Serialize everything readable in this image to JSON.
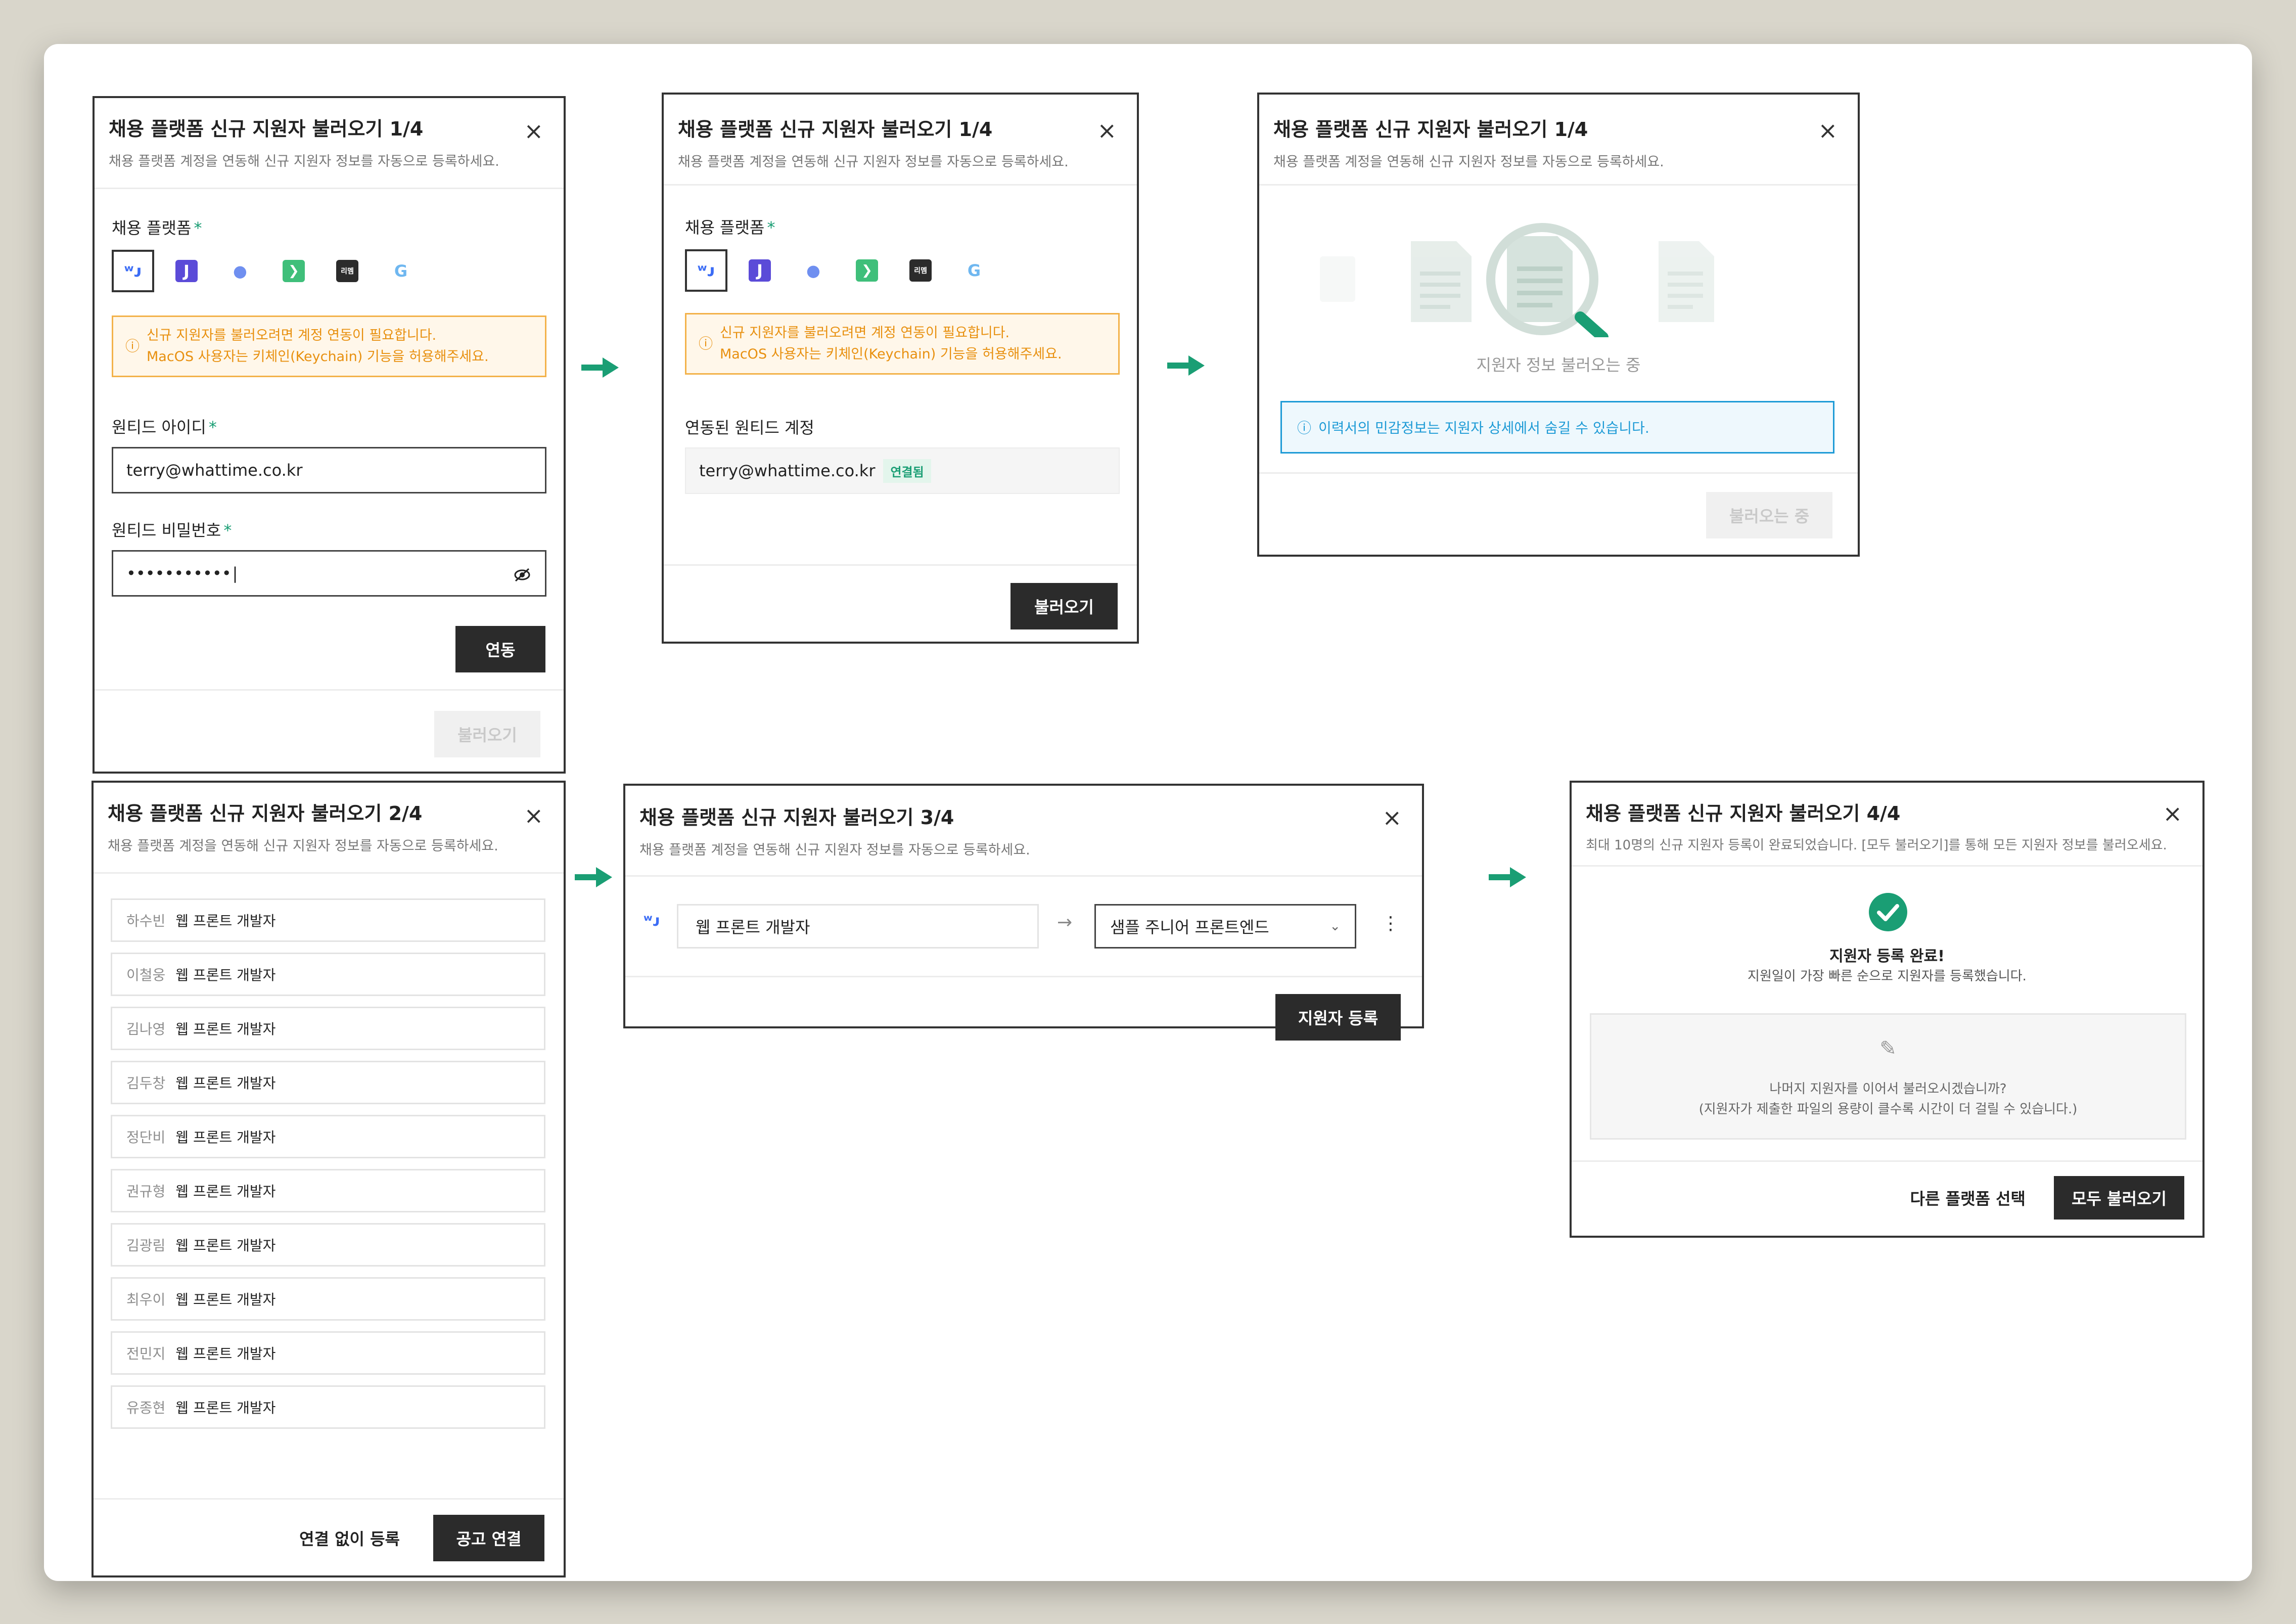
{
  "colors": {
    "accent": "#1a9e74",
    "warning": "#f3b24a",
    "info": "#1e9bd6",
    "dark_button": "#2b2b2b"
  },
  "common": {
    "title_step1": "채용 플랫폼 신규 지원자 불러오기 1/4",
    "title_step2": "채용 플랫폼 신규 지원자 불러오기 2/4",
    "title_step3": "채용 플랫폼 신규 지원자 불러오기 3/4",
    "title_step4": "채용 플랫폼 신규 지원자 불러오기 4/4",
    "subtitle": "채용 플랫폼 계정을 연동해 신규 지원자 정보를 자동으로 등록하세요.",
    "close": "×",
    "arrow_icon": "arrow-right-icon"
  },
  "step1a": {
    "platform_label": "채용 플랫폼",
    "required_mark": "*",
    "platforms": [
      {
        "name": "wanted",
        "glyph": "ʷᴊ",
        "color": "#3b6cf5"
      },
      {
        "name": "jumpit",
        "glyph": "J",
        "color": "#5b4bd8"
      },
      {
        "name": "rocketpunch",
        "glyph": "●",
        "color": "#6f8ff0"
      },
      {
        "name": "programmers",
        "glyph": "❯",
        "color": "#3fbf7a"
      },
      {
        "name": "remember",
        "glyph": "리멤",
        "color": "#2b2b2b"
      },
      {
        "name": "saramin",
        "glyph": "G",
        "color": "#6fb7f0"
      }
    ],
    "warning_line1": "신규 지원자를 불러오려면 계정 연동이 필요합니다.",
    "warning_line2": "MacOS 사용자는 키체인(Keychain) 기능을 허용해주세요.",
    "id_label": "원티드 아이디",
    "id_value": "terry@whattime.co.kr",
    "pw_label": "원티드 비밀번호",
    "pw_value": "•••••••••••",
    "connect_button": "연동",
    "load_button": "불러오기"
  },
  "step1b": {
    "linked_label": "연동된 원티드 계정",
    "linked_value": "terry@whattime.co.kr",
    "linked_badge": "연결됨",
    "load_button": "불러오기"
  },
  "step1c": {
    "loading_text": "지원자 정보 불러오는 중",
    "info_text": "이력서의 민감정보는 지원자 상세에서 숨길 수 있습니다.",
    "loading_button": "불러오는 중"
  },
  "step2": {
    "applicants": [
      {
        "name": "하수빈",
        "job": "웹 프론트 개발자"
      },
      {
        "name": "이철웅",
        "job": "웹 프론트 개발자"
      },
      {
        "name": "김나영",
        "job": "웹 프론트 개발자"
      },
      {
        "name": "김두창",
        "job": "웹 프론트 개발자"
      },
      {
        "name": "정단비",
        "job": "웹 프론트 개발자"
      },
      {
        "name": "권규형",
        "job": "웹 프론트 개발자"
      },
      {
        "name": "김광림",
        "job": "웹 프론트 개발자"
      },
      {
        "name": "최우이",
        "job": "웹 프론트 개발자"
      },
      {
        "name": "전민지",
        "job": "웹 프론트 개발자"
      },
      {
        "name": "유종현",
        "job": "웹 프론트 개발자"
      }
    ],
    "register_without_button": "연결 없이 등록",
    "connect_posting_button": "공고 연결"
  },
  "step3": {
    "source_job": "웹 프론트 개발자",
    "target_posting": "샘플 주니어 프론트엔드",
    "more": "⋮",
    "register_button": "지원자 등록"
  },
  "step4": {
    "subtitle": "최대 10명의 신규 지원자 등록이 완료되었습니다. [모두 불러오기]를 통해 모든 지원자 정보를 불러오세요.",
    "done_title": "지원자 등록 완료!",
    "done_desc": "지원일이 가장 빠른 순으로 지원자를 등록했습니다.",
    "more_q1": "나머지 지원자를 이어서 불러오시겠습니까?",
    "more_q2": "(지원자가 제출한 파일의 용량이 클수록 시간이 더 걸릴 수 있습니다.)",
    "other_platform_button": "다른 플랫폼 선택",
    "load_all_button": "모두 불러오기"
  }
}
